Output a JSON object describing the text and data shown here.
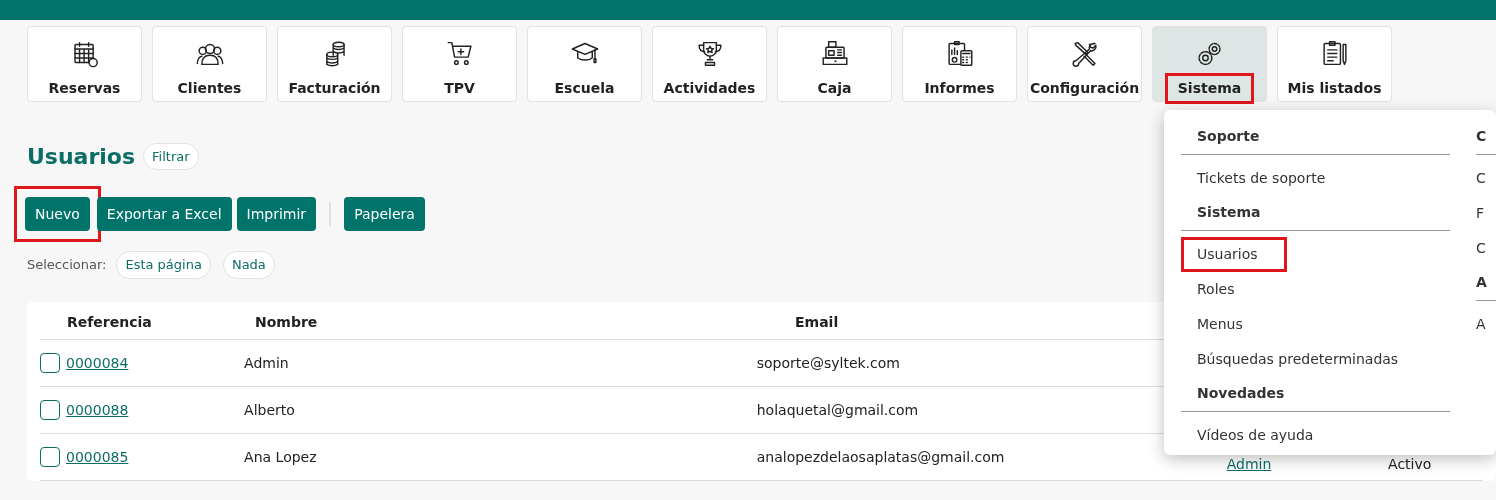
{
  "modules": [
    {
      "label": "Reservas",
      "selected": false,
      "highlighted": false
    },
    {
      "label": "Clientes",
      "selected": false,
      "highlighted": false
    },
    {
      "label": "Facturación",
      "selected": false,
      "highlighted": false
    },
    {
      "label": "TPV",
      "selected": false,
      "highlighted": false
    },
    {
      "label": "Escuela",
      "selected": false,
      "highlighted": false
    },
    {
      "label": "Actividades",
      "selected": false,
      "highlighted": false
    },
    {
      "label": "Caja",
      "selected": false,
      "highlighted": false
    },
    {
      "label": "Informes",
      "selected": false,
      "highlighted": false
    },
    {
      "label": "Configuración",
      "selected": false,
      "highlighted": false
    },
    {
      "label": "Sistema",
      "selected": true,
      "highlighted": true
    },
    {
      "label": "Mis listados",
      "selected": false,
      "highlighted": false
    }
  ],
  "page": {
    "title": "Usuarios",
    "filter_button": "Filtrar"
  },
  "actions": [
    {
      "label": "Nuevo",
      "highlighted": true
    },
    {
      "label": "Exportar a Excel",
      "highlighted": false
    },
    {
      "label": "Imprimir",
      "highlighted": false
    },
    {
      "label": "Papelera",
      "highlighted": false
    }
  ],
  "select": {
    "label": "Seleccionar:",
    "options": [
      "Esta página",
      "Nada"
    ]
  },
  "table": {
    "columns": [
      "Referencia",
      "Nombre",
      "Email"
    ],
    "rows": [
      {
        "checked": false,
        "reference": "0000084",
        "name": "Admin",
        "email": "soporte@syltek.com"
      },
      {
        "checked": false,
        "reference": "0000088",
        "name": "Alberto",
        "email": "holaquetal@gmail.com"
      },
      {
        "checked": false,
        "reference": "0000085",
        "name": "Ana Lopez",
        "email": "analopezdelaosaplatas@gmail.com",
        "column_4": "Admin",
        "column_5": "Activo"
      }
    ]
  },
  "dropdown": {
    "columns": [
      {
        "sections": [
          {
            "heading": "Soporte",
            "items": [
              {
                "label": "Tickets de soporte",
                "highlighted": false
              }
            ]
          },
          {
            "heading": "Sistema",
            "items": [
              {
                "label": "Usuarios",
                "highlighted": true
              },
              {
                "label": "Roles",
                "highlighted": false
              },
              {
                "label": "Menus",
                "highlighted": false
              },
              {
                "label": "Búsquedas predeterminadas",
                "highlighted": false
              }
            ]
          },
          {
            "heading": "Novedades",
            "items": [
              {
                "label": "Vídeos de ayuda",
                "highlighted": false
              }
            ]
          }
        ]
      },
      {
        "sections": [
          {
            "heading": "C",
            "items": [
              {
                "label": "C",
                "highlighted": false
              },
              {
                "label": "F",
                "highlighted": false
              },
              {
                "label": "C",
                "highlighted": false
              }
            ]
          },
          {
            "heading": "A",
            "items": [
              {
                "label": "A",
                "highlighted": false
              }
            ]
          }
        ]
      }
    ]
  }
}
